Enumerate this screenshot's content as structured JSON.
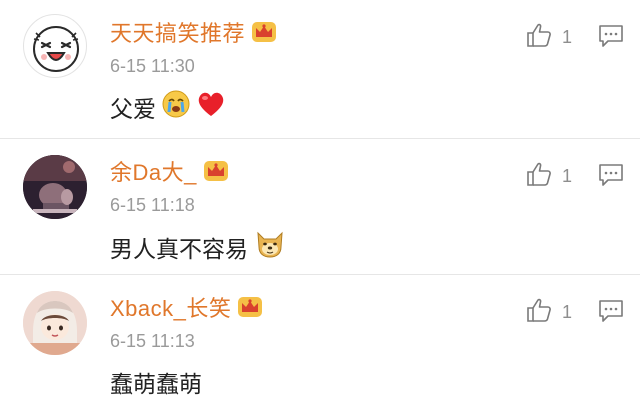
{
  "colors": {
    "username": "#e0772b",
    "meta": "#9a9a9a",
    "text": "#222222",
    "divider": "#e6e6e6"
  },
  "comments": [
    {
      "username": "天天搞笑推荐",
      "time": "6-15 11:30",
      "text": "父爱",
      "likes": "1",
      "avatar_icon": "cartoon-face-avatar",
      "emojis": [
        "crying-emoji",
        "heart-emoji"
      ]
    },
    {
      "username": "余Da大_",
      "time": "6-15 11:18",
      "text": "男人真不容易",
      "likes": "1",
      "avatar_icon": "photo-avatar",
      "emojis": [
        "doge-emoji"
      ]
    },
    {
      "username": "Xback_长笑",
      "time": "6-15 11:13",
      "text": "蠢萌蠢萌",
      "likes": "1",
      "avatar_icon": "anime-girl-avatar",
      "emojis": []
    }
  ]
}
